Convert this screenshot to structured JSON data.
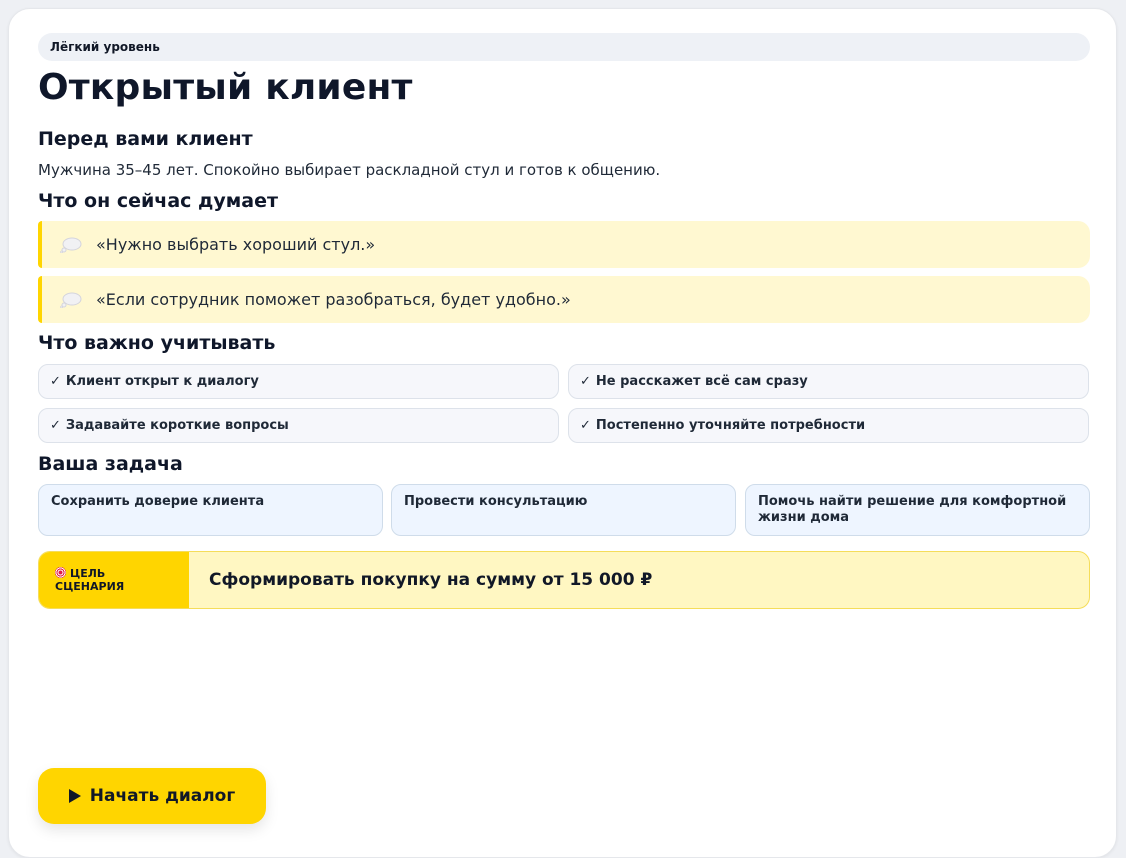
{
  "level_label": "Лёгкий уровень",
  "title": "Открытый клиент",
  "client": {
    "heading": "Перед вами клиент",
    "description": "Мужчина 35–45 лет. Спокойно выбирает раскладной стул и готов к общению."
  },
  "thoughts": {
    "heading": "Что он сейчас думает",
    "icon": "thought-bubble-icon",
    "items": [
      "«Нужно выбрать хороший стул.»",
      "«Если сотрудник поможет разобраться, будет удобно.»"
    ]
  },
  "considerations": {
    "heading": "Что важно учитывать",
    "check_mark": "✓",
    "items": [
      "Клиент открыт к диалогу",
      "Не расскажет всё сам сразу",
      "Задавайте короткие вопросы",
      "Постепенно уточняйте потребности"
    ]
  },
  "tasks": {
    "heading": "Ваша задача",
    "items": [
      "Сохранить доверие клиента",
      "Провести консультацию",
      "Помочь найти решение для комфортной жизни дома"
    ]
  },
  "goal": {
    "label_line1": "ЦЕЛЬ",
    "label_line2": "СЦЕНАРИЯ",
    "icon": "target-icon",
    "text": "Сформировать покупку на сумму от 15 000 ₽"
  },
  "start_button": {
    "label": "Начать диалог",
    "icon": "play-icon"
  },
  "colors": {
    "accent": "#ffd500",
    "thought_bg": "#fff8d1",
    "chip_bg": "#f6f7fb",
    "task_bg": "#eef5ff",
    "goal_bg": "#fff7c2"
  }
}
